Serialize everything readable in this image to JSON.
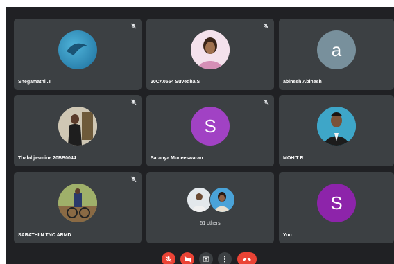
{
  "tiles": [
    {
      "name": "Snegamathi .T"
    },
    {
      "name": "20CA0554 Suvedha.S"
    },
    {
      "name": "abinesh Abinesh",
      "letter": "a",
      "color": "#78909c"
    },
    {
      "name": "Thalal jasmine 20BB0044"
    },
    {
      "name": "Saranya Muneeswaran",
      "letter": "S",
      "color": "#a142c4"
    },
    {
      "name": "MOHIT R"
    },
    {
      "name": "SARATHI N TNC ARMD"
    },
    {
      "others_label": "51 others"
    },
    {
      "name": "You",
      "letter": "S",
      "color": "#8d24aa"
    }
  ],
  "controls": [
    {
      "icon": "mic-off-icon"
    },
    {
      "icon": "camera-off-icon"
    },
    {
      "icon": "present-screen-icon"
    },
    {
      "icon": "more-options-icon"
    },
    {
      "icon": "end-call-icon"
    }
  ],
  "colors": {
    "background": "#202124",
    "tile": "#3c4043",
    "danger": "#ea4335"
  }
}
